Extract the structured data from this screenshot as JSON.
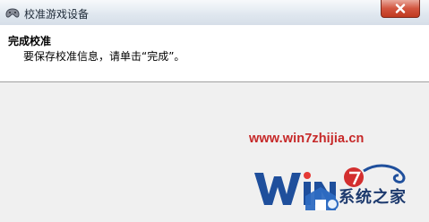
{
  "window": {
    "title": "校准游戏设备"
  },
  "header": {
    "title": "完成校准",
    "subtitle": "要保存校准信息，请单击“完成”。"
  },
  "watermark": {
    "url": "www.win7zhijia.cn",
    "brand_text": "系统之家"
  },
  "colors": {
    "watermark_red": "#c62828",
    "logo_blue": "#1d3a6e",
    "close_button": "#c0391f"
  },
  "icons": {
    "app": "game-controller-icon",
    "close": "close-icon",
    "logo": "win7-logo-icon"
  }
}
